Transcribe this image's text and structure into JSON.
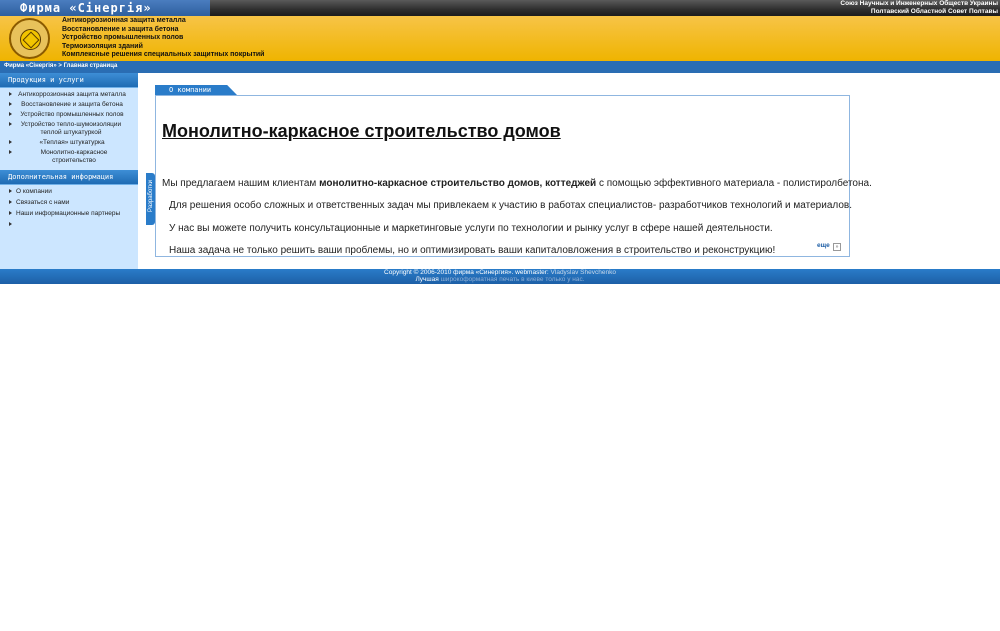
{
  "header": {
    "firm_title": "Фирма «Сінергія»",
    "union_line1": "Союз Научных и Инженерных Обществ Украины",
    "union_line2": "Полтавский Областной Совет Полтавы",
    "services": [
      "Антикоррозионная защита металла",
      "Восстановление и защита бетона",
      "Устройство промышленных полов",
      "Термоизоляция зданий",
      "Комплексные решения специальных защитных покрытий"
    ]
  },
  "breadcrumb": "Фирма «Сінергія» > Главная страница",
  "sidebar": {
    "products_head": "Продукция и услуги",
    "products": [
      "Антикоррозионная защита металла",
      "Восстановление и защита бетона",
      "Устройство промышленных полов",
      "Устройство тепло-шумоизоляции теплой штукатуркой",
      "«Теплая» штукатурка",
      "Монолитно-каркасное строительство"
    ],
    "info_head": "Дополнительная информация",
    "info": [
      "О компании",
      "Связаться с нами",
      "Наши информационные партнеры",
      ""
    ]
  },
  "content": {
    "tab_label": "О компании",
    "side_tab": "Разработки",
    "title": "Монолитно-каркасное строительство домов",
    "para1_pre": "Мы предлагаем нашим клиентам ",
    "para1_bold": "монолитно-каркасное строительство домов, коттеджей",
    "para1_post": " с помощью эффективного материала - полистиролбетона.",
    "para2": "Для решения особо сложных и ответственных задач мы привлекаем к участию в работах специалистов- разработчиков технологий и материалов.",
    "para3": "У нас вы можете получить консультационные и маркетинговые услуги по технологии и рынку услуг в сфере нашей деятельности.",
    "para4": "Наша задача не только решить ваши проблемы, но и оптимизировать ваши капиталовложения в строительство и реконструкцию!",
    "more": "еще"
  },
  "footer": {
    "copyright": "Copyright © 2006-2010 фирма «Синергия». webmaster:",
    "webmaster": "Vladyslav Shevchenko",
    "ad_prefix": "Лучшая",
    "ad_text": "широкоформатная печать в киеве только у нас."
  }
}
